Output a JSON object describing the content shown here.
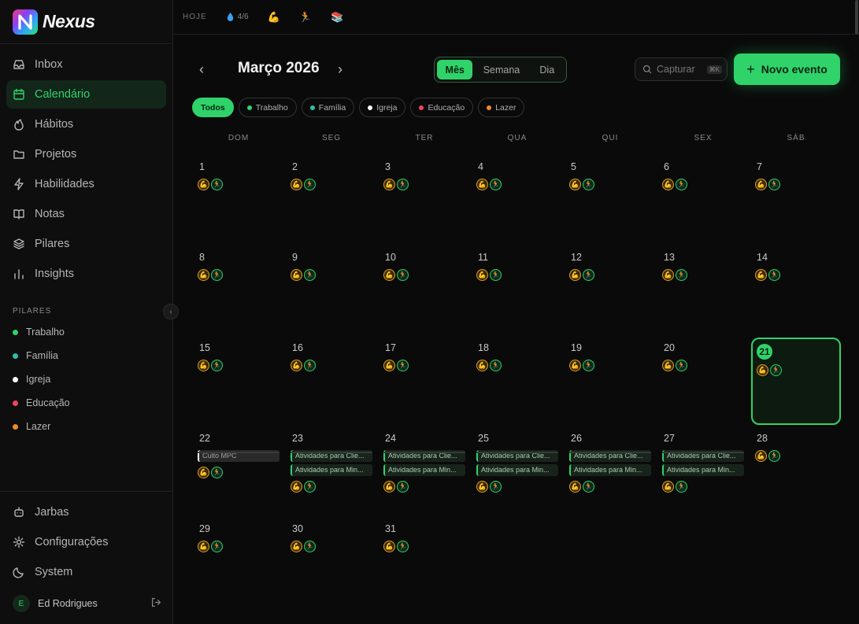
{
  "brand": {
    "name": "Nexus"
  },
  "nav": [
    {
      "id": "inbox",
      "label": "Inbox",
      "icon": "inbox-icon",
      "active": false
    },
    {
      "id": "calendario",
      "label": "Calendário",
      "icon": "calendar-icon",
      "active": true
    },
    {
      "id": "habitos",
      "label": "Hábitos",
      "icon": "flame-icon",
      "active": false
    },
    {
      "id": "projetos",
      "label": "Projetos",
      "icon": "folder-icon",
      "active": false
    },
    {
      "id": "habilidades",
      "label": "Habilidades",
      "icon": "lightning-icon",
      "active": false
    },
    {
      "id": "notas",
      "label": "Notas",
      "icon": "book-icon",
      "active": false
    },
    {
      "id": "pilares",
      "label": "Pilares",
      "icon": "layers-icon",
      "active": false
    },
    {
      "id": "insights",
      "label": "Insights",
      "icon": "bar-chart-icon",
      "active": false
    }
  ],
  "pillars_label": "PILARES",
  "pillars": [
    {
      "label": "Trabalho",
      "color": "#2fd36a"
    },
    {
      "label": "Família",
      "color": "#2fbfaa"
    },
    {
      "label": "Igreja",
      "color": "#ffffff"
    },
    {
      "label": "Educação",
      "color": "#f0455f"
    },
    {
      "label": "Lazer",
      "color": "#f08a2a"
    }
  ],
  "bottom_nav": [
    {
      "label": "Jarbas",
      "icon": "robot-icon"
    },
    {
      "label": "Configurações",
      "icon": "gear-icon"
    },
    {
      "label": "System",
      "icon": "moon-icon"
    }
  ],
  "user": {
    "initial": "E",
    "name": "Ed Rodrigues"
  },
  "topbar": {
    "today_label": "HOJE",
    "water": "4/6",
    "habit_icons": [
      "muscle-icon",
      "runner-icon",
      "books-icon"
    ]
  },
  "calendar": {
    "title": "Março 2026",
    "views": [
      {
        "label": "Mês",
        "active": true
      },
      {
        "label": "Semana",
        "active": false
      },
      {
        "label": "Dia",
        "active": false
      }
    ],
    "search_placeholder": "Capturar",
    "search_shortcut": "⌘K",
    "new_event_label": "Novo evento",
    "filters": [
      {
        "label": "Todos",
        "active": true,
        "color": ""
      },
      {
        "label": "Trabalho",
        "active": false,
        "color": "#2fd36a"
      },
      {
        "label": "Família",
        "active": false,
        "color": "#2fbfaa"
      },
      {
        "label": "Igreja",
        "active": false,
        "color": "#ffffff"
      },
      {
        "label": "Educação",
        "active": false,
        "color": "#f0455f"
      },
      {
        "label": "Lazer",
        "active": false,
        "color": "#f08a2a"
      }
    ],
    "weekdays": [
      "DOM",
      "SEG",
      "TER",
      "QUA",
      "QUI",
      "SEX",
      "SÁB"
    ],
    "today": 21,
    "days_in_month": 31,
    "event_days": {
      "22": [
        {
          "label": "Culto MPC",
          "pillar": "igreja"
        }
      ],
      "23": [
        {
          "label": "Atividades para Clie...",
          "pillar": "trabalho"
        },
        {
          "label": "Atividades para Min...",
          "pillar": "trabalho"
        }
      ],
      "24": [
        {
          "label": "Atividades para Clie...",
          "pillar": "trabalho"
        },
        {
          "label": "Atividades para Min...",
          "pillar": "trabalho"
        }
      ],
      "25": [
        {
          "label": "Atividades para Clie...",
          "pillar": "trabalho"
        },
        {
          "label": "Atividades para Min...",
          "pillar": "trabalho"
        }
      ],
      "26": [
        {
          "label": "Atividades para Clie...",
          "pillar": "trabalho"
        },
        {
          "label": "Atividades para Min...",
          "pillar": "trabalho"
        }
      ],
      "27": [
        {
          "label": "Atividades para Clie...",
          "pillar": "trabalho"
        },
        {
          "label": "Atividades para Min...",
          "pillar": "trabalho"
        }
      ]
    },
    "day_habits": [
      "muscle-icon",
      "runner-icon"
    ]
  }
}
